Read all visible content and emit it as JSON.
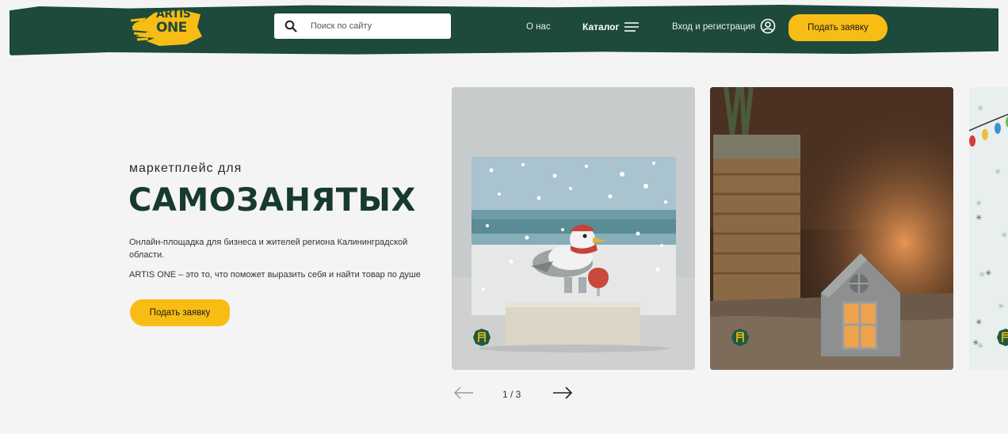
{
  "header": {
    "logo_line1": "ARTIS",
    "logo_line2": "ONE",
    "search_placeholder": "Поиск по сайту",
    "nav_about": "О нас",
    "nav_catalog": "Каталог",
    "nav_login": "Вход и регистрация",
    "cta_label": "Подать заявку"
  },
  "hero": {
    "eyebrow": "маркетплейс для",
    "headline": "САМОЗАНЯТЫХ",
    "description_1": "Онлайн-площадка для бизнеса и жителей региона Калининградской области.",
    "description_2": "ARTIS ONE – это то, что поможет выразить себя и найти товар по душе",
    "cta_label": "Подать заявку"
  },
  "pager": {
    "counter": "1 / 3"
  },
  "colors": {
    "brand_green": "#1d4a3a",
    "accent_yellow": "#f8bd14",
    "headline": "#173a2d"
  },
  "icons": [
    "logo-icon",
    "search-icon",
    "menu-icon",
    "user-icon",
    "chair-badge-icon",
    "arrow-left-icon",
    "arrow-right-icon"
  ]
}
